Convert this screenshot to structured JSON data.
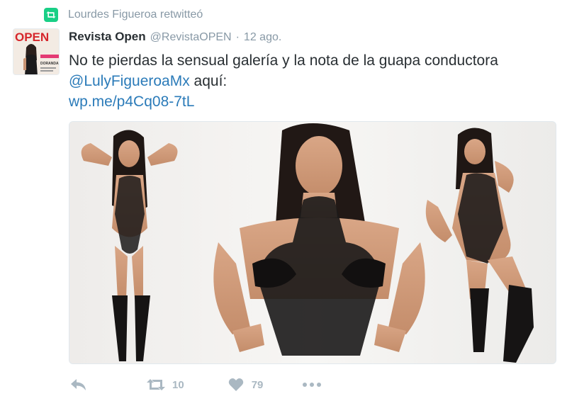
{
  "retweet_context": {
    "text": "Lourdes Figueroa retwitteó",
    "icon": "retweet-badge-icon",
    "color": "#19cf86"
  },
  "avatar": {
    "magazine_title": "OPEN",
    "cover_text": "DORANDA GÓMEZ"
  },
  "tweet": {
    "display_name": "Revista Open",
    "handle": "@RevistaOPEN",
    "separator": "·",
    "timestamp": "12 ago.",
    "text_line1": "No te pierdas la sensual galería y la nota de la guapa conductora",
    "mention": "@LulyFigueroaMx",
    "text_after_mention": " aquí:",
    "link": "wp.me/p4Cq08-7tL",
    "link_color": "#2b7bb9"
  },
  "media": {
    "description_icon": "photo-collage",
    "panels": 3
  },
  "actions": {
    "reply_icon": "reply-icon",
    "retweet_icon": "retweet-icon",
    "retweet_count": "10",
    "like_icon": "heart-icon",
    "like_count": "79",
    "more_icon": "more-dots-icon",
    "icon_color": "#aab8c2"
  }
}
